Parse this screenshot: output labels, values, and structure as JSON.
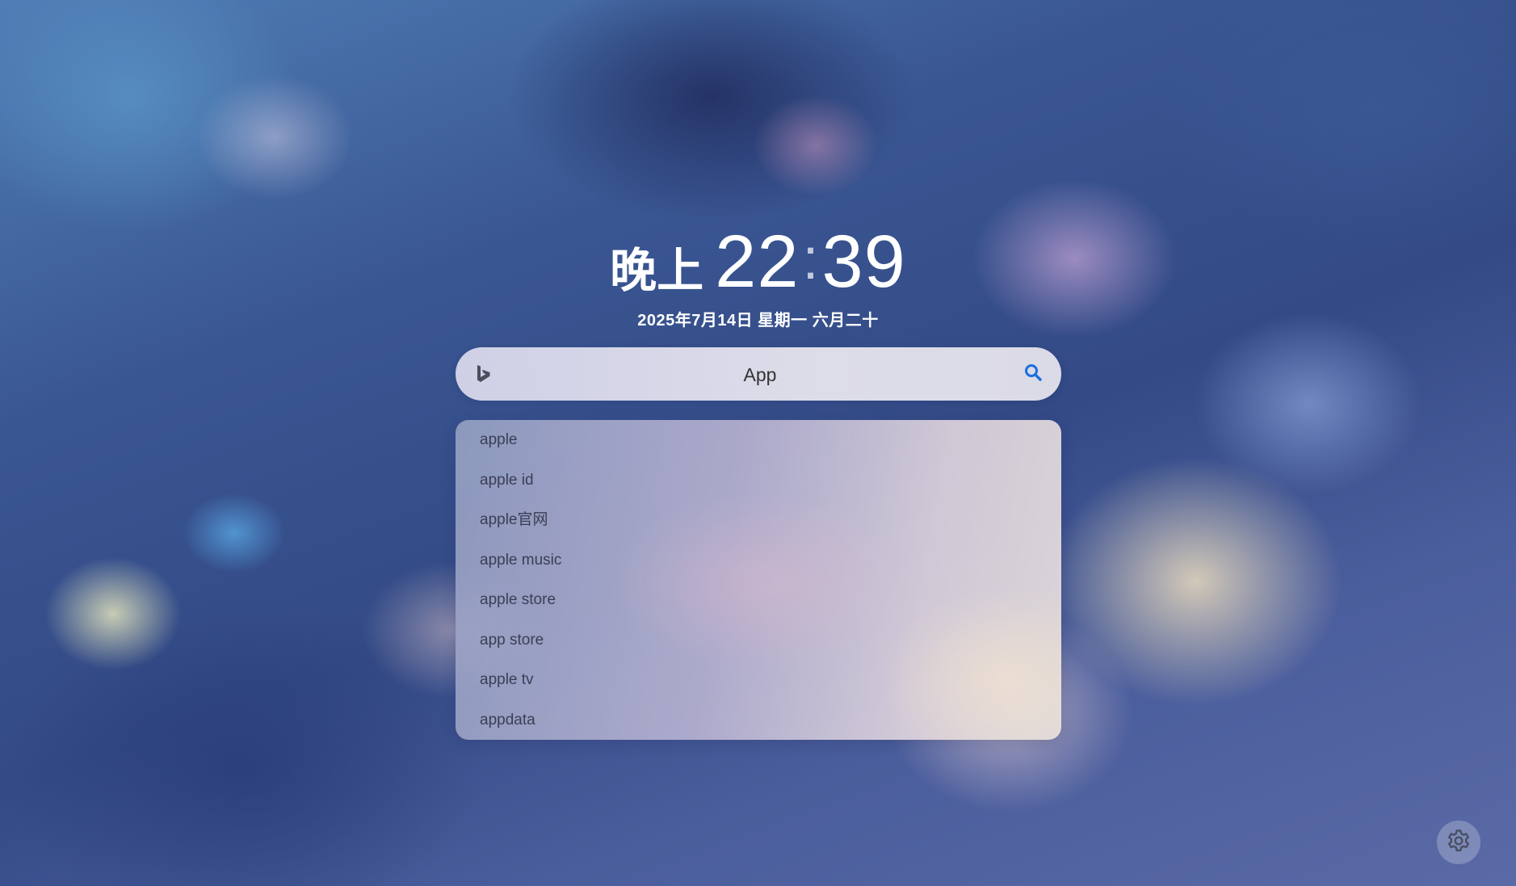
{
  "clock": {
    "period": "晚上",
    "hours": "22",
    "colon": ":",
    "minutes": "39"
  },
  "date_line": "2025年7月14日 星期一 六月二十",
  "search": {
    "engine_icon": "bing-icon",
    "value": "App",
    "placeholder": "",
    "button_icon": "search-icon",
    "accent_color": "#1a6fe0"
  },
  "suggestions": [
    "apple",
    "apple id",
    "apple官网",
    "apple music",
    "apple store",
    "app store",
    "apple tv",
    "appdata"
  ],
  "settings": {
    "icon": "gear-icon"
  }
}
